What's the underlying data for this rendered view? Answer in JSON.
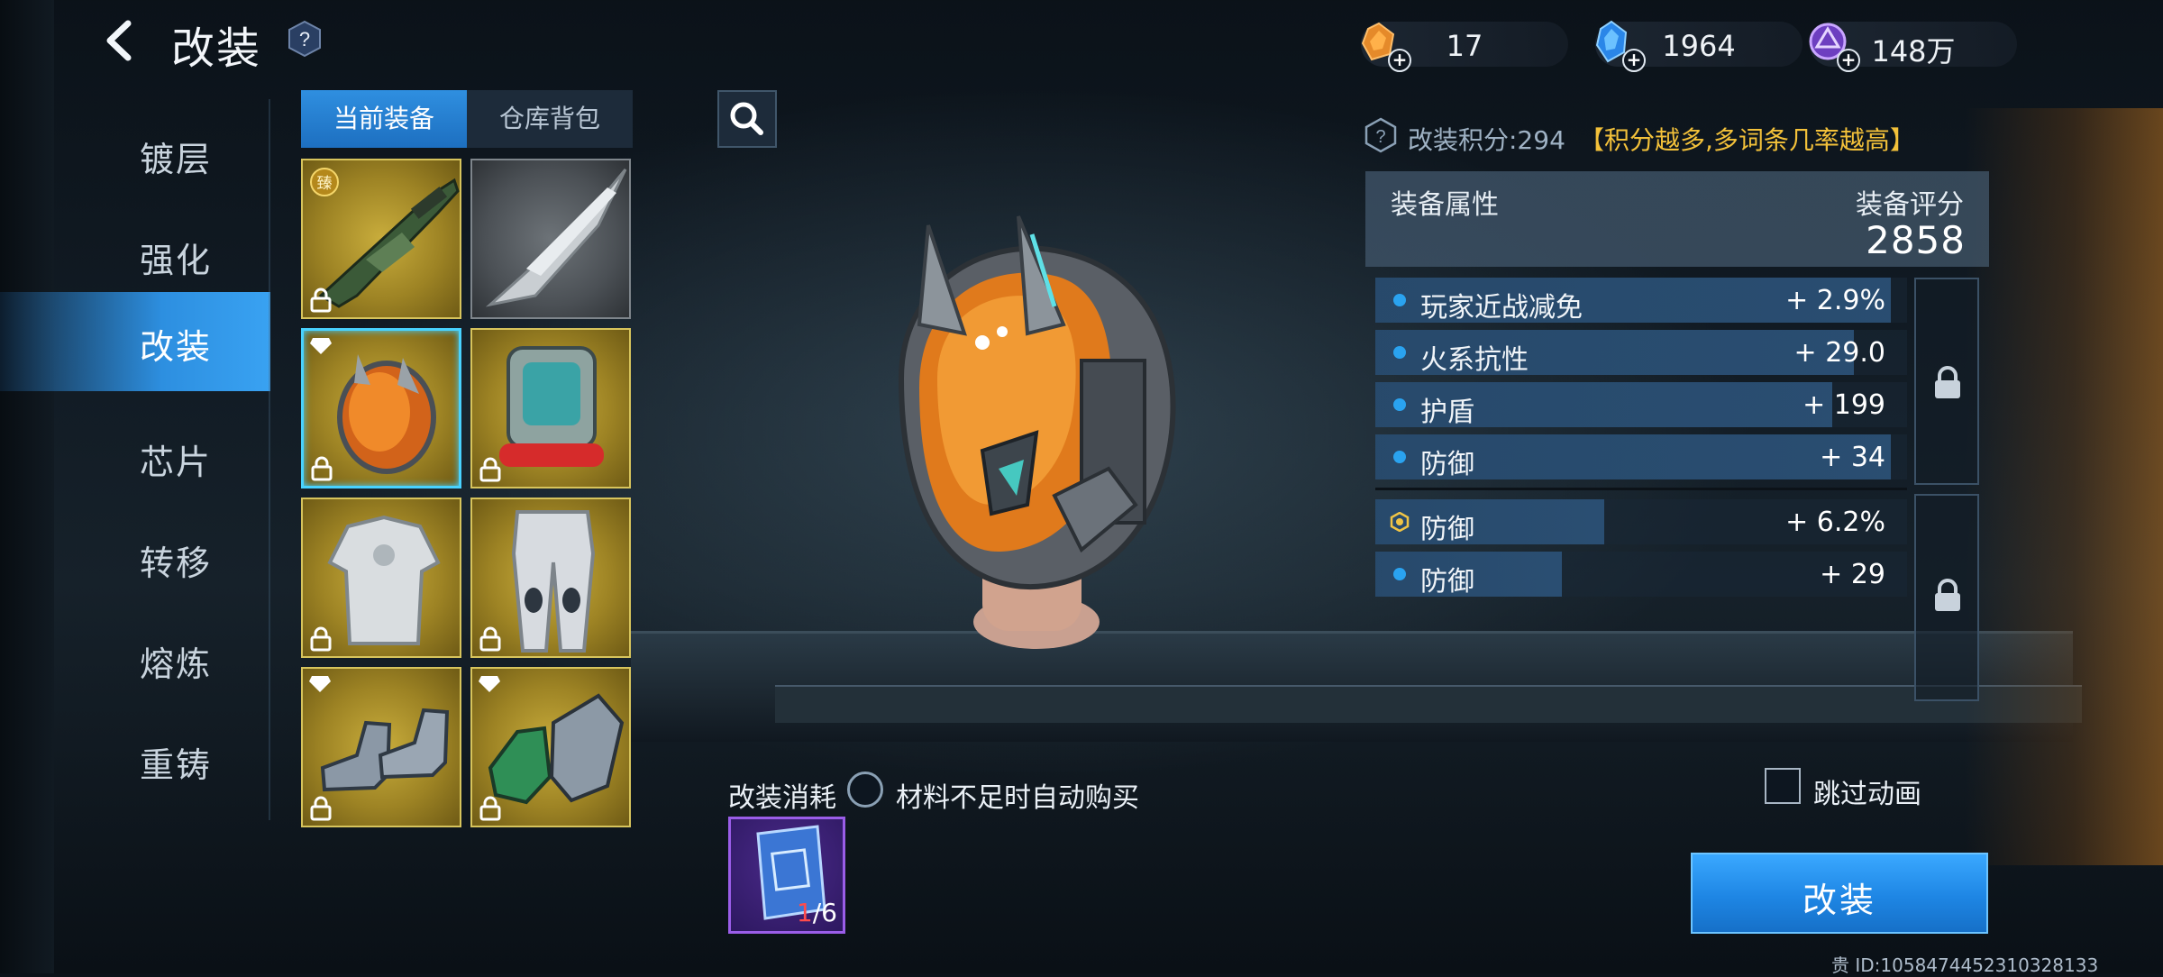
{
  "header": {
    "title": "改装",
    "help_symbol": "?"
  },
  "currencies": [
    {
      "icon": "orange-crystal-icon",
      "value": "17"
    },
    {
      "icon": "blue-crystal-icon",
      "value": "1964"
    },
    {
      "icon": "purple-coin-icon",
      "value": "148万"
    }
  ],
  "nav": {
    "items": [
      {
        "label": "镀层"
      },
      {
        "label": "强化"
      },
      {
        "label": "改装",
        "active": true
      },
      {
        "label": "芯片"
      },
      {
        "label": "转移"
      },
      {
        "label": "熔炼"
      },
      {
        "label": "重铸"
      }
    ]
  },
  "tabs": {
    "current": "当前装备",
    "warehouse": "仓库背包"
  },
  "equipment": [
    {
      "type": "rifle",
      "rarity": "gold",
      "locked": true,
      "badge": "臻"
    },
    {
      "type": "blade-rifle",
      "rarity": "gray",
      "locked": false
    },
    {
      "type": "helmet",
      "rarity": "gold",
      "locked": true,
      "selected": true,
      "gem": true
    },
    {
      "type": "backpack",
      "rarity": "gold",
      "locked": true
    },
    {
      "type": "chest-armor",
      "rarity": "gold",
      "locked": true
    },
    {
      "type": "leg-armor",
      "rarity": "gold",
      "locked": true
    },
    {
      "type": "boots",
      "rarity": "gold",
      "locked": true,
      "gem": true
    },
    {
      "type": "gloves",
      "rarity": "gold",
      "locked": true,
      "gem": true
    }
  ],
  "score": {
    "label": "改装积分:294",
    "hint": "【积分越多,多词条几率越高】"
  },
  "attributes": {
    "title": "装备属性",
    "rating_label": "装备评分",
    "rating_value": "2858",
    "group1": [
      {
        "name": "玩家近战减免",
        "value": "+ 2.9%",
        "fill": 0.97
      },
      {
        "name": "火系抗性",
        "value": "+ 29.0",
        "fill": 0.9
      },
      {
        "name": "护盾",
        "value": "+ 199",
        "fill": 0.86
      },
      {
        "name": "防御",
        "value": "+ 34",
        "fill": 0.97
      }
    ],
    "group2": [
      {
        "name": "防御",
        "value": "+ 6.2%",
        "fill": 0.43,
        "special": true
      },
      {
        "name": "防御",
        "value": "+ 29",
        "fill": 0.35
      }
    ]
  },
  "bottom": {
    "cost_label": "改装消耗",
    "auto_buy_label": "材料不足时自动购买",
    "material_have": "1",
    "material_need": "/6",
    "skip_label": "跳过动画",
    "action_button": "改装",
    "uid": "ID:1058474452310328133",
    "uid_prefix": "贵"
  }
}
